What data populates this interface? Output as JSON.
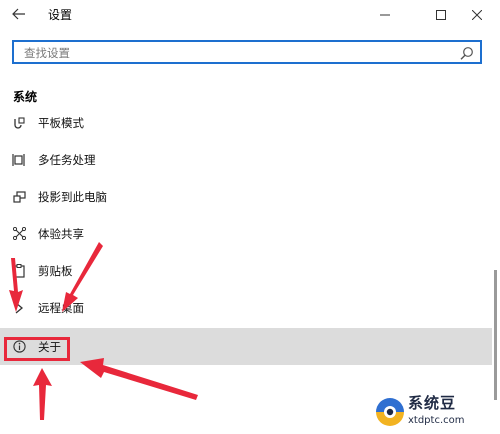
{
  "window": {
    "title": "设置",
    "back_icon": "back-arrow-icon",
    "minimize_icon": "minimize-icon",
    "maximize_icon": "maximize-icon",
    "close_icon": "close-icon"
  },
  "search": {
    "placeholder": "查找设置",
    "value": "",
    "icon": "search-icon"
  },
  "section": {
    "title": "系统"
  },
  "menu": {
    "items": [
      {
        "label": "平板模式",
        "icon": "tablet-mode-icon"
      },
      {
        "label": "多任务处理",
        "icon": "multitasking-icon"
      },
      {
        "label": "投影到此电脑",
        "icon": "project-icon"
      },
      {
        "label": "体验共享",
        "icon": "shared-experiences-icon"
      },
      {
        "label": "剪贴板",
        "icon": "clipboard-icon"
      },
      {
        "label": "远程桌面",
        "icon": "remote-desktop-icon"
      },
      {
        "label": "关于",
        "icon": "info-icon",
        "selected": true
      }
    ]
  },
  "annotation": {
    "highlight_color": "#e8283b"
  },
  "watermark": {
    "line1": "系统豆",
    "line2": "xtdptc.com",
    "logo_icon": "watermark-logo-icon"
  },
  "colors": {
    "accent": "#1d6fcf",
    "selected_bg": "#dcdcdc"
  }
}
